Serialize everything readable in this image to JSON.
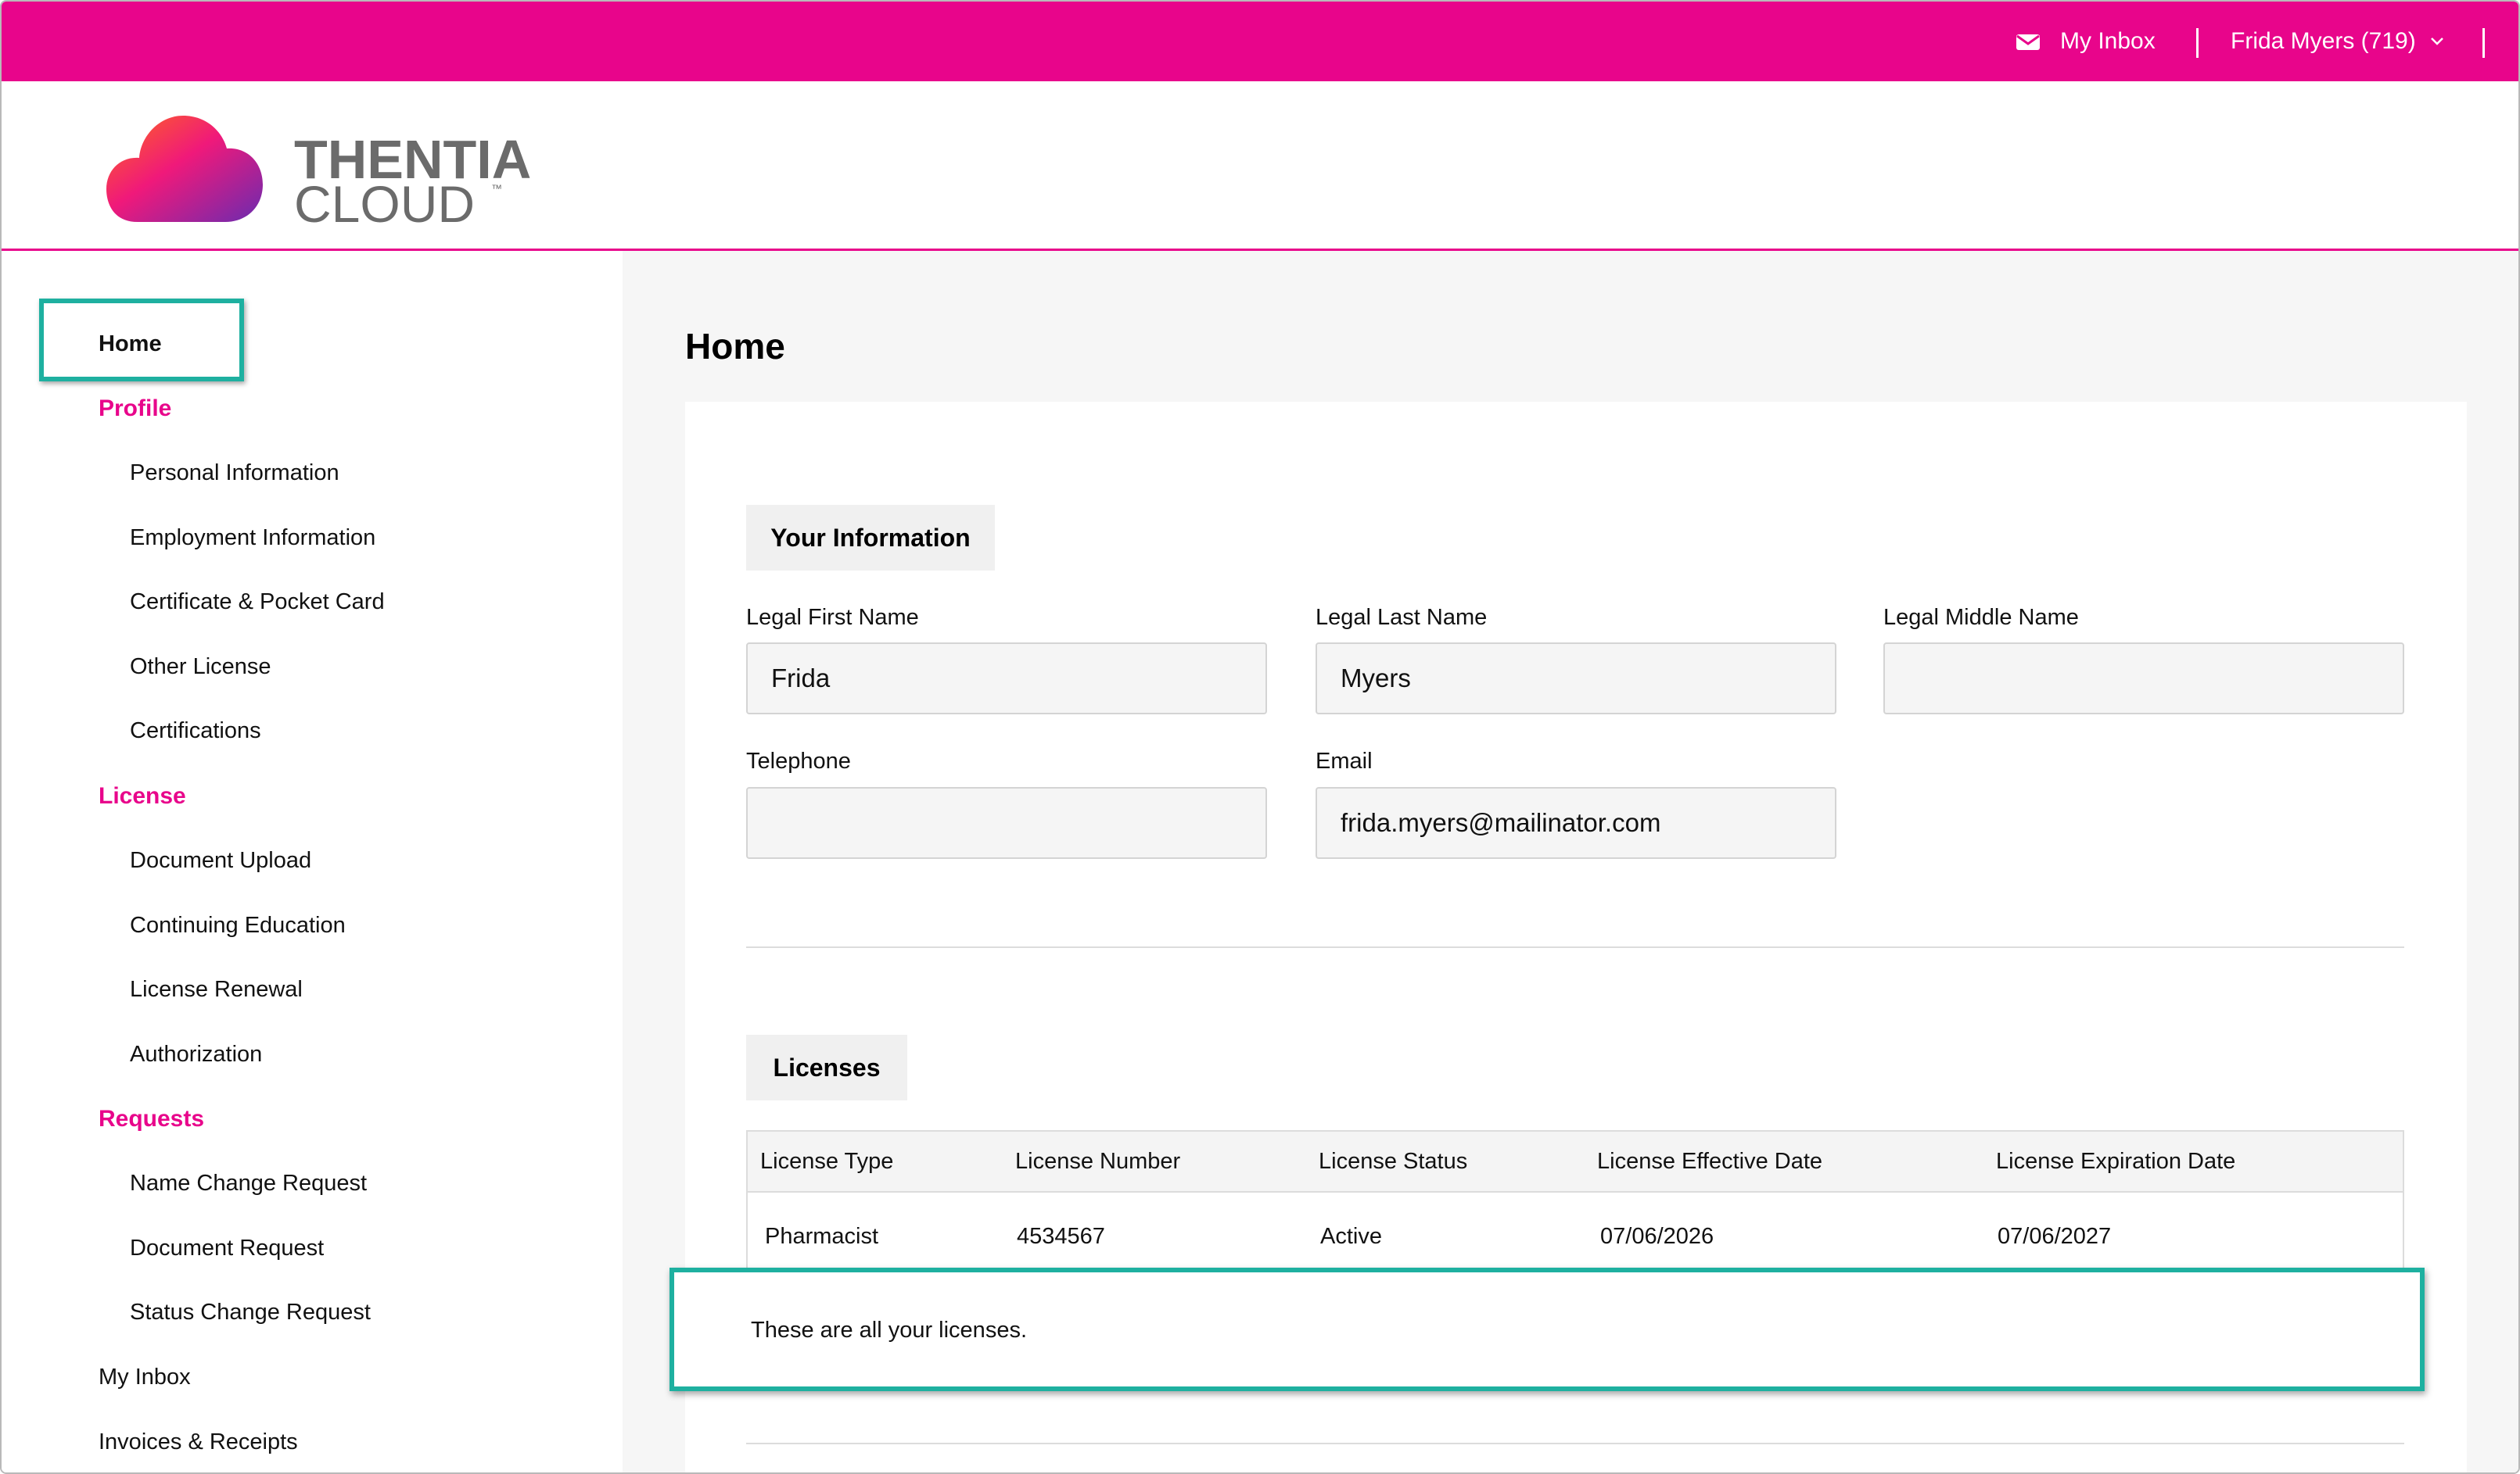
{
  "topbar": {
    "inbox_label": "My Inbox",
    "user_label": "Frida Myers (719)",
    "background": "#e8058b"
  },
  "brand": {
    "name_line1": "THENTIA",
    "name_line2": "CLOUD",
    "trademark": "™"
  },
  "sidebar": {
    "home": "Home",
    "profile_section": "Profile",
    "profile_items": [
      "Personal Information",
      "Employment Information",
      "Certificate & Pocket Card",
      "Other License",
      "Certifications"
    ],
    "license_section": "License",
    "license_items": [
      "Document Upload",
      "Continuing Education",
      "License Renewal",
      "Authorization"
    ],
    "requests_section": "Requests",
    "requests_items": [
      "Name Change Request",
      "Document Request",
      "Status Change Request"
    ],
    "inbox": "My Inbox",
    "invoices": "Invoices & Receipts",
    "accent_color": "#e8058b"
  },
  "main": {
    "title": "Home",
    "your_info": {
      "heading": "Your Information",
      "fields": {
        "first_name": {
          "label": "Legal First Name",
          "value": "Frida"
        },
        "last_name": {
          "label": "Legal Last Name",
          "value": "Myers"
        },
        "middle_name": {
          "label": "Legal Middle Name",
          "value": ""
        },
        "telephone": {
          "label": "Telephone",
          "value": ""
        },
        "email": {
          "label": "Email",
          "value": "frida.myers@mailinator.com"
        }
      }
    },
    "licenses": {
      "heading": "Licenses",
      "columns": [
        "License Type",
        "License Number",
        "License Status",
        "License Effective Date",
        "License Expiration Date"
      ],
      "rows": [
        [
          "Pharmacist",
          "4534567",
          "Active",
          "07/06/2026",
          "07/06/2027"
        ]
      ],
      "note": "These are all your licenses."
    }
  },
  "highlight_color": "#1eb0a0"
}
